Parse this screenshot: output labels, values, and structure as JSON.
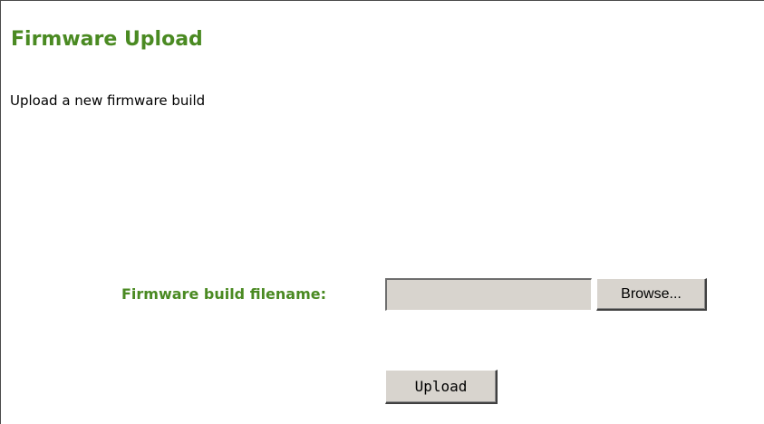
{
  "page": {
    "title": "Firmware Upload",
    "subtitle": "Upload a new firmware build"
  },
  "form": {
    "file_label": "Firmware build filename:",
    "file_value": "",
    "browse_label": "Browse...",
    "upload_label": "Upload"
  },
  "colors": {
    "accent_green": "#4a8a22",
    "control_face": "#d8d4ce",
    "frame_border": "#4a4a4a"
  }
}
